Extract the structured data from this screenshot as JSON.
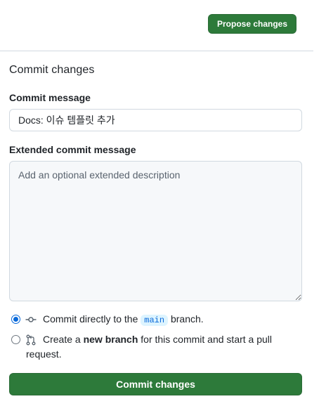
{
  "header": {
    "propose_label": "Propose changes"
  },
  "commit": {
    "title": "Commit changes",
    "message_label": "Commit message",
    "message_value": "Docs: 이슈 템플릿 추가",
    "extended_label": "Extended commit message",
    "extended_placeholder": "Add an optional extended description",
    "option_direct": {
      "prefix": "Commit directly to the",
      "branch": "main",
      "suffix": "branch.",
      "selected": true,
      "icon": "git-commit-icon"
    },
    "option_new": {
      "prefix": "Create a",
      "bold": "new branch",
      "suffix": "for this commit and start a pull",
      "line2": "request.",
      "selected": false,
      "icon": "git-pull-request-icon"
    },
    "submit_label": "Commit changes"
  },
  "colors": {
    "primary_green": "#2d7a3a",
    "accent_blue": "#0969da",
    "border": "#d1d9e0"
  }
}
